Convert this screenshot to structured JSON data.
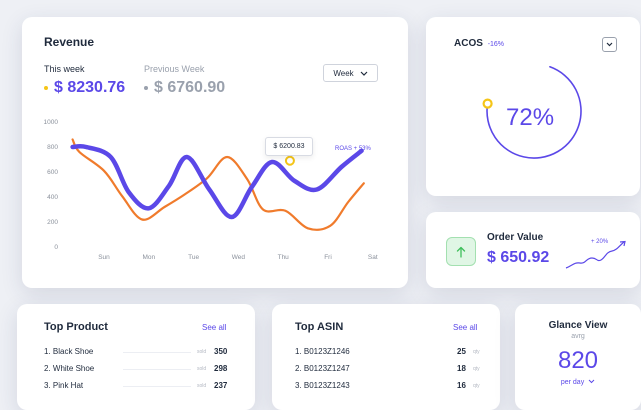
{
  "revenue": {
    "title": "Revenue",
    "this_week_label": "This week",
    "this_week_value": "$ 8230.76",
    "prev_week_label": "Previous Week",
    "prev_week_value": "$ 6760.90",
    "period_select": "Week",
    "tooltip": "$ 6200.83",
    "roas_label": "ROAS + 53%",
    "colors": {
      "current": "#5b48e8",
      "previous": "#f07b2c",
      "this_week_dot": "#f5c518",
      "prev_week_dot": "#9aa1ad"
    }
  },
  "chart_data": {
    "type": "line",
    "categories": [
      "Sun",
      "Mon",
      "Tue",
      "Wed",
      "Thu",
      "Fri",
      "Sat"
    ],
    "yticks": [
      "1000",
      "800",
      "600",
      "400",
      "200",
      "0"
    ],
    "ylim": [
      0,
      1000
    ],
    "series": [
      {
        "key": "current",
        "points": [
          [
            -0.7,
            800
          ],
          [
            -0.4,
            800
          ],
          [
            0.15,
            720
          ],
          [
            0.55,
            440
          ],
          [
            1.0,
            310
          ],
          [
            1.45,
            490
          ],
          [
            1.85,
            720
          ],
          [
            2.35,
            460
          ],
          [
            2.85,
            240
          ],
          [
            3.3,
            480
          ],
          [
            3.75,
            680
          ],
          [
            4.25,
            530
          ],
          [
            4.75,
            460
          ],
          [
            5.3,
            640
          ],
          [
            5.75,
            770
          ]
        ]
      },
      {
        "key": "previous",
        "points": [
          [
            -0.7,
            860
          ],
          [
            -0.55,
            760
          ],
          [
            0.0,
            610
          ],
          [
            0.4,
            410
          ],
          [
            0.85,
            220
          ],
          [
            1.35,
            320
          ],
          [
            1.8,
            420
          ],
          [
            2.3,
            550
          ],
          [
            2.75,
            720
          ],
          [
            3.2,
            540
          ],
          [
            3.55,
            300
          ],
          [
            4.05,
            290
          ],
          [
            4.55,
            150
          ],
          [
            5.05,
            170
          ],
          [
            5.45,
            360
          ],
          [
            5.8,
            510
          ]
        ]
      }
    ],
    "highlight": {
      "x": 4.15,
      "y": 690
    }
  },
  "acos": {
    "title": "ACOS",
    "change": "-16%",
    "percent": "72%",
    "value": 72,
    "colors": {
      "arc": "#5b48e8",
      "knob": "#f5c518"
    }
  },
  "order_value": {
    "title": "Order Value",
    "value": "$ 650.92",
    "change": "+ 20%",
    "colors": {
      "icon_bg": "#e0f6e5",
      "icon": "#3fbf5c"
    }
  },
  "top_product": {
    "title": "Top Product",
    "see_all": "See all",
    "rows": [
      {
        "name": "1. Black Shoe",
        "unit": "sold",
        "value": "350"
      },
      {
        "name": "2. White Shoe",
        "unit": "sold",
        "value": "298"
      },
      {
        "name": "3. Pink Hat",
        "unit": "sold",
        "value": "237"
      }
    ]
  },
  "top_asin": {
    "title": "Top ASIN",
    "see_all": "See all",
    "rows": [
      {
        "name": "1. B0123Z1246",
        "unit": "qty",
        "value": "25"
      },
      {
        "name": "2. B0123Z1247",
        "unit": "qty",
        "value": "18"
      },
      {
        "name": "3. B0123Z1243",
        "unit": "qty",
        "value": "16"
      }
    ]
  },
  "glance": {
    "title": "Glance View",
    "subtitle": "avrg",
    "value": "820",
    "period": "per day"
  }
}
